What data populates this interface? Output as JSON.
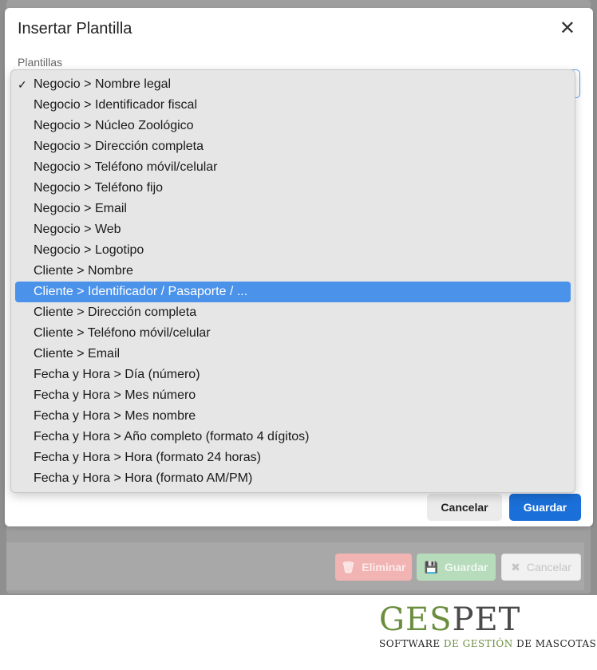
{
  "background": {
    "buttons": {
      "delete_label": "Eliminar",
      "save_label": "Guardar",
      "cancel_label": "Cancelar"
    }
  },
  "modal": {
    "title": "Insertar Plantilla",
    "field_label": "Plantillas",
    "cancel_label": "Cancelar",
    "save_label": "Guardar"
  },
  "dropdown": {
    "selected_index": 0,
    "highlighted_index": 10,
    "options": [
      "Negocio > Nombre legal",
      "Negocio > Identificador fiscal",
      "Negocio > Núcleo Zoológico",
      "Negocio > Dirección completa",
      "Negocio > Teléfono móvil/celular",
      "Negocio > Teléfono fijo",
      "Negocio > Email",
      "Negocio > Web",
      "Negocio > Logotipo",
      "Cliente > Nombre",
      "Cliente > Identificador / Pasaporte / ...",
      "Cliente > Dirección completa",
      "Cliente > Teléfono móvil/celular",
      "Cliente > Email",
      "Fecha y Hora > Día (número)",
      "Fecha y Hora > Mes número",
      "Fecha y Hora > Mes nombre",
      "Fecha y Hora > Año completo (formato 4 dígitos)",
      "Fecha y Hora > Hora (formato 24 horas)",
      "Fecha y Hora > Hora (formato AM/PM)"
    ]
  },
  "branding": {
    "word_left": "GES",
    "word_right": "PET",
    "tagline_a": "SOFTWARE",
    "tagline_b": "DE GESTIÓN",
    "tagline_c": "DE MASCOTAS"
  },
  "colors": {
    "accent": "#1a6fd8",
    "highlight": "#4b92ea",
    "brand_green": "#6b8e3e"
  }
}
